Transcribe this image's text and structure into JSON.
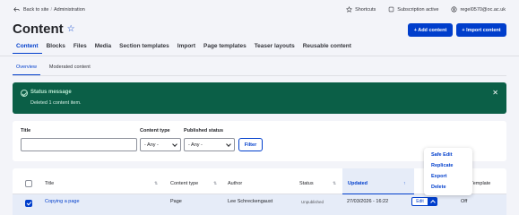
{
  "topbar": {
    "back_label": "Back to site",
    "section": "Administration",
    "shortcuts": "Shortcuts",
    "subscription": "Subscription active",
    "user": "regel0570@oc.ac.uk"
  },
  "page": {
    "title": "Content"
  },
  "actions": {
    "add_content": "+ Add content",
    "import_content": "+ Import content"
  },
  "primary_tabs": [
    "Content",
    "Blocks",
    "Files",
    "Media",
    "Section templates",
    "Import",
    "Page templates",
    "Teaser layouts",
    "Reusable content"
  ],
  "secondary_tabs": [
    "Overview",
    "Moderated content"
  ],
  "status": {
    "title": "Status message",
    "message": "Deleted 1 content item."
  },
  "filters": {
    "title_label": "Title",
    "title_value": "",
    "content_type_label": "Content type",
    "content_type_value": "- Any -",
    "published_label": "Published status",
    "published_value": "- Any -",
    "filter_button": "Filter"
  },
  "table": {
    "columns": [
      "Title",
      "Content type",
      "Author",
      "Status",
      "Updated",
      "Template"
    ],
    "row": {
      "title": "Copying a page",
      "content_type": "Page",
      "author": "Lee Schreckengaust",
      "status": "Unpublished",
      "updated": "27/03/2026 - 16:22",
      "edit": "Edit",
      "template": "Off"
    }
  },
  "dropdown": [
    "Safe Edit",
    "Replicate",
    "Export",
    "Delete"
  ],
  "colors": {
    "accent": "#003ecc",
    "status_bg": "#0b5f47",
    "page_bg": "#f3f4f9"
  }
}
